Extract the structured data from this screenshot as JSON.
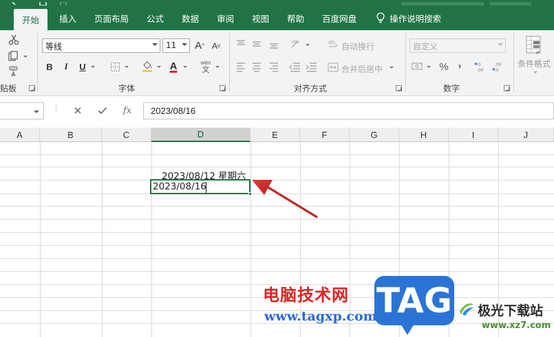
{
  "ribbon_tabs": [
    {
      "label": "开始",
      "active": true
    },
    {
      "label": "插入"
    },
    {
      "label": "页面布局"
    },
    {
      "label": "公式"
    },
    {
      "label": "数据"
    },
    {
      "label": "审阅"
    },
    {
      "label": "视图"
    },
    {
      "label": "帮助"
    },
    {
      "label": "百度网盘"
    },
    {
      "label": "操作说明搜索",
      "icon": "lightbulb-icon"
    }
  ],
  "clipboard": {
    "label": "贴板"
  },
  "font": {
    "name": "等线",
    "size": "11",
    "label": "字体",
    "bold": "B",
    "italic": "I",
    "underline": "U",
    "grow": "A",
    "shrink": "A",
    "font_color_letter": "A",
    "font_color": "#e02222",
    "phonetic_top": "wén",
    "phonetic_bottom": "文"
  },
  "alignment": {
    "wrap_text": "自动换行",
    "merge_center": "合并后居中",
    "label": "对齐方式"
  },
  "number": {
    "format": "自定义",
    "label": "数字",
    "percent": "%",
    "comma": ","
  },
  "styles": {
    "conditional_format": "条件格式"
  },
  "formula_bar": {
    "fx": "fx",
    "value": "2023/08/16"
  },
  "columns": [
    "A",
    "B",
    "C",
    "D",
    "E",
    "F",
    "G",
    "H",
    "I",
    "J"
  ],
  "selected_column": "D",
  "cells": {
    "d_above": "2023/08/12 星期六",
    "d_active": "2023/08/16"
  },
  "watermark": {
    "cn_title": "电脑技术网",
    "url": "www.tagxp.com",
    "tag": "TAG",
    "jg_name": "极光下载站",
    "jg_url": "www.xz7.com"
  },
  "colors": {
    "accent": "#217346",
    "arrow": "#d42a2a"
  }
}
